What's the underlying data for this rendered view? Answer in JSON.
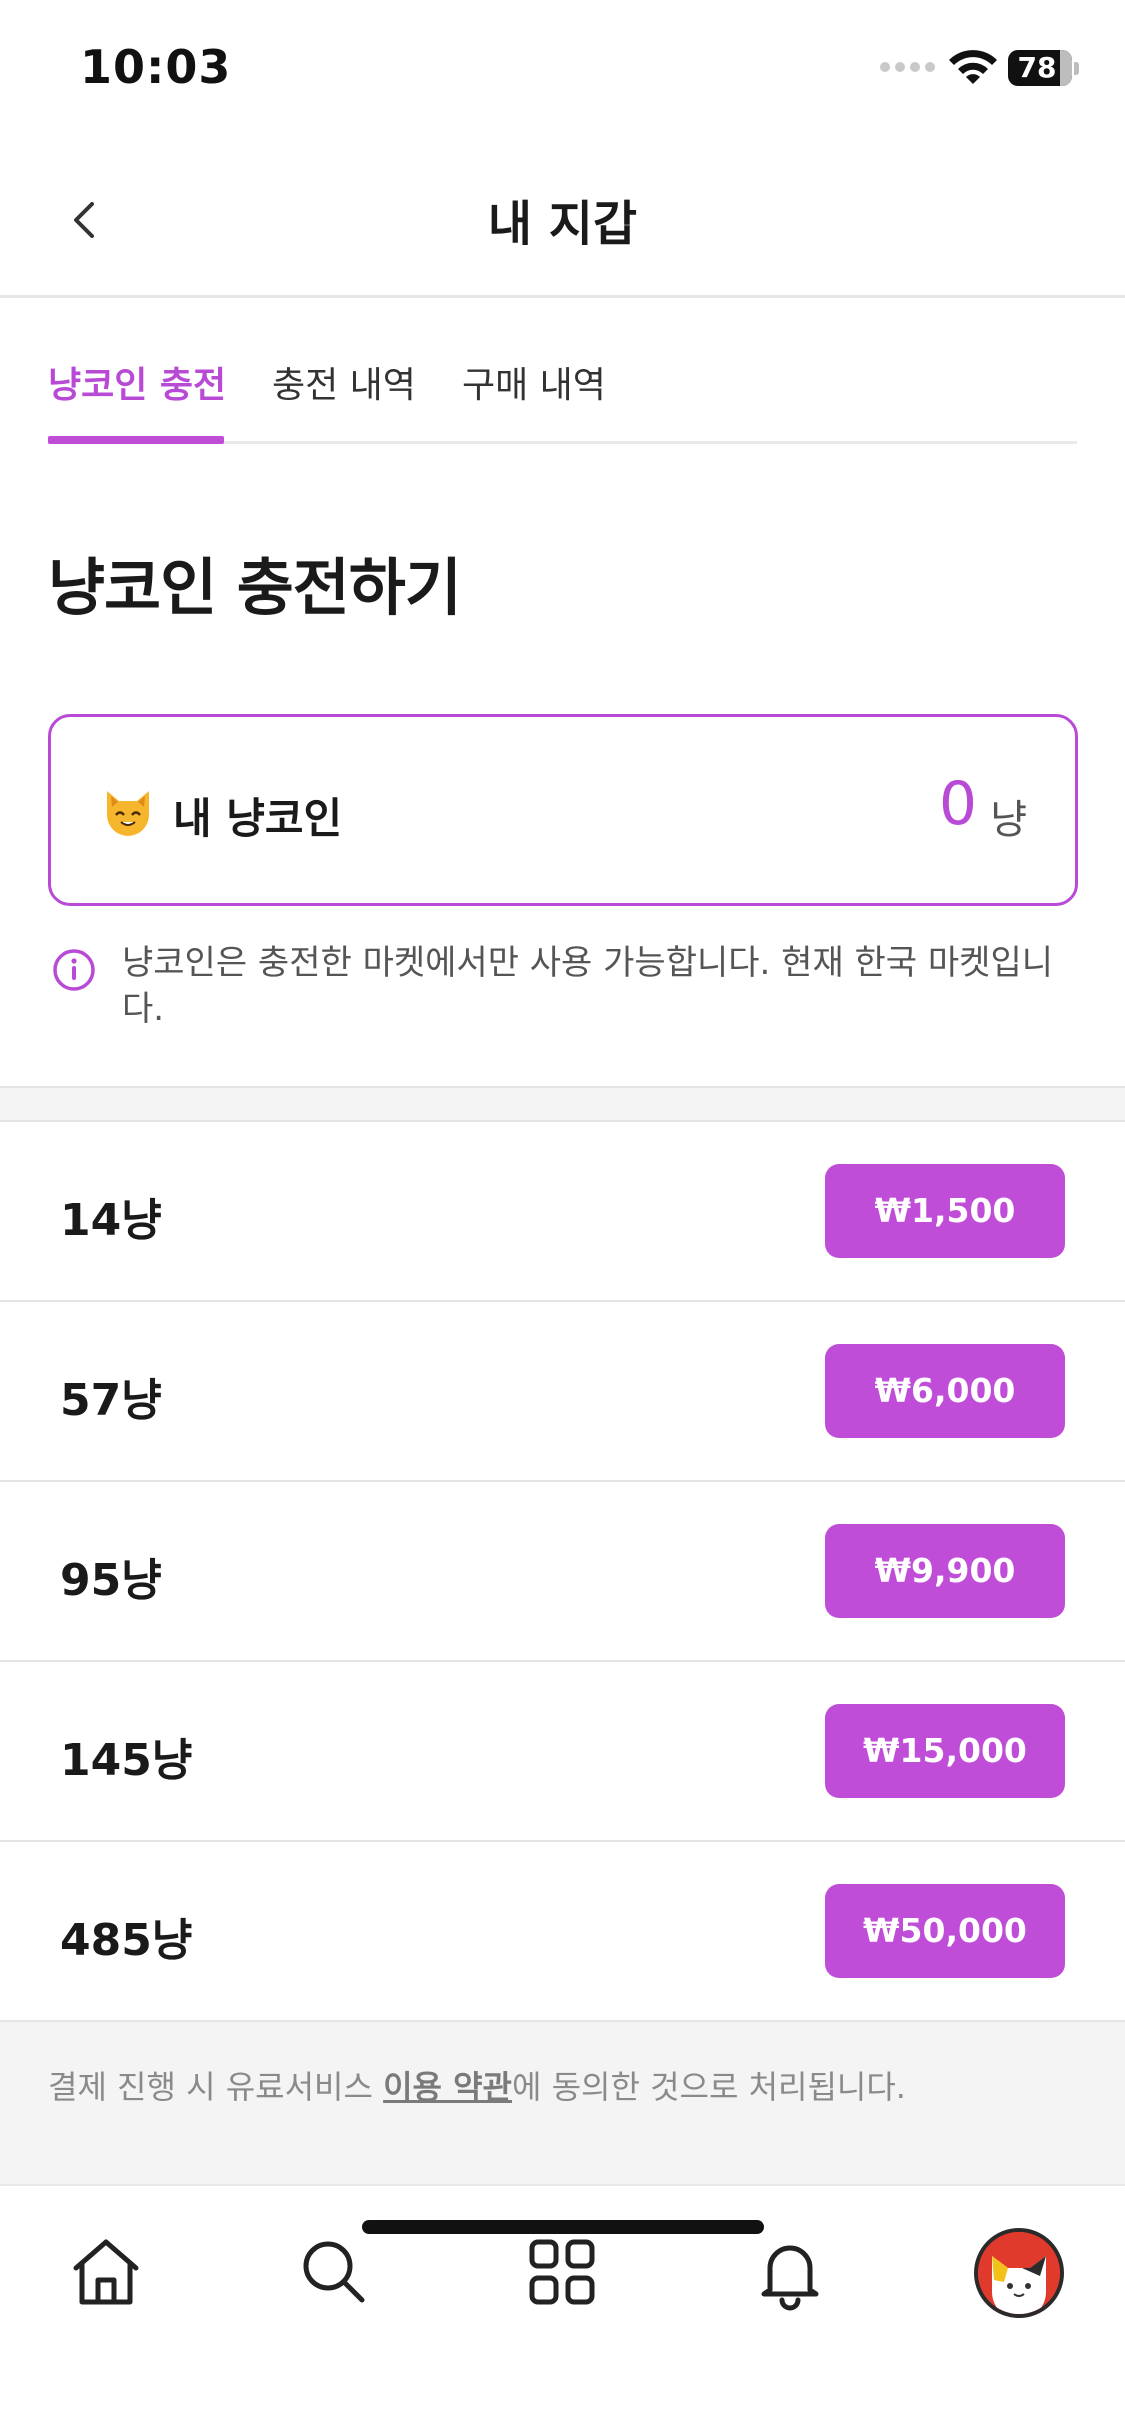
{
  "status_bar": {
    "time": "10:03",
    "battery": "78"
  },
  "header": {
    "title": "내 지갑",
    "back_icon": "chevron-left-icon"
  },
  "tabs": [
    {
      "label": "냥코인 충전",
      "active": true
    },
    {
      "label": "충전 내역",
      "active": false
    },
    {
      "label": "구매 내역",
      "active": false
    }
  ],
  "section_title": "냥코인 충전하기",
  "coin_card": {
    "icon": "cat-face-icon",
    "label": "내 냥코인",
    "value": "0",
    "unit": "냥"
  },
  "notice": {
    "icon": "info-icon",
    "text": "냥코인은 충전한 마켓에서만 사용 가능합니다. 현재 한국 마켓입니다."
  },
  "products": [
    {
      "amount": "14냥",
      "price": "₩1,500"
    },
    {
      "amount": "57냥",
      "price": "₩6,000"
    },
    {
      "amount": "95냥",
      "price": "₩9,900"
    },
    {
      "amount": "145냥",
      "price": "₩15,000"
    },
    {
      "amount": "485냥",
      "price": "₩50,000"
    }
  ],
  "footer": {
    "prefix": "결제 진행 시 유료서비스 ",
    "link": "이용 약관",
    "suffix": "에 동의한 것으로 처리됩니다."
  },
  "tab_bar": {
    "items": [
      "home-icon",
      "search-icon",
      "grid-icon",
      "bell-icon",
      "profile-avatar"
    ]
  },
  "colors": {
    "accent": "#c04dd8",
    "accent_text": "#b84ad6"
  }
}
